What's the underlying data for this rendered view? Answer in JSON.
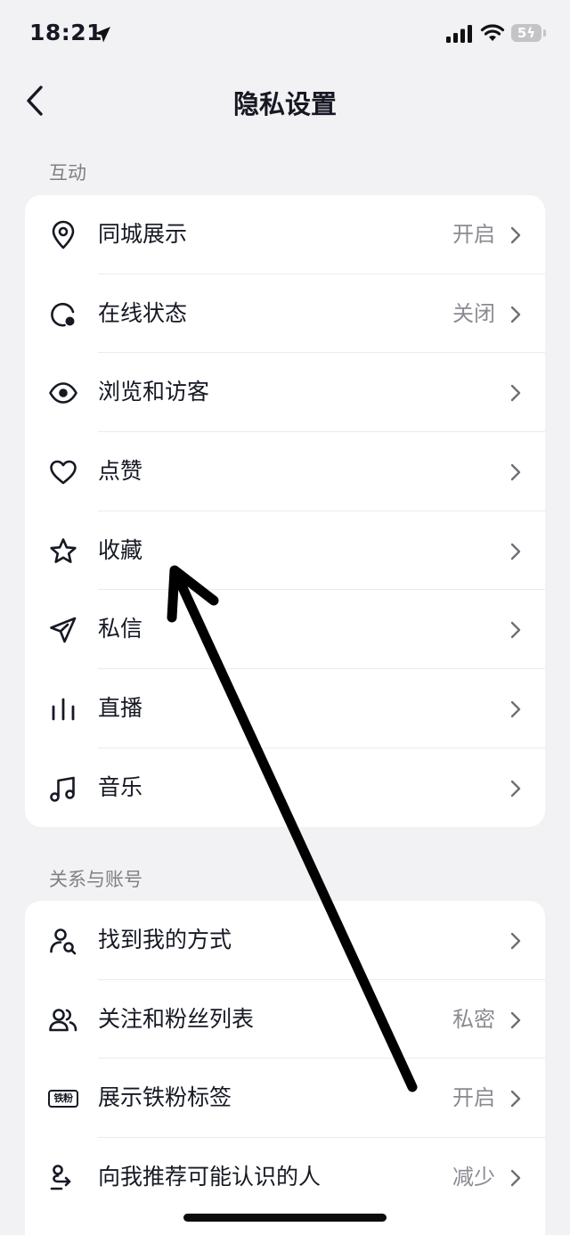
{
  "status_bar": {
    "time": "18:21",
    "battery": "5"
  },
  "header": {
    "title": "隐私设置"
  },
  "sections": [
    {
      "label": "互动",
      "items": [
        {
          "label": "同城展示",
          "value": "开启",
          "icon": "location-pin-icon"
        },
        {
          "label": "在线状态",
          "value": "关闭",
          "icon": "online-status-icon"
        },
        {
          "label": "浏览和访客",
          "value": "",
          "icon": "eye-icon"
        },
        {
          "label": "点赞",
          "value": "",
          "icon": "heart-icon"
        },
        {
          "label": "收藏",
          "value": "",
          "icon": "star-icon"
        },
        {
          "label": "私信",
          "value": "",
          "icon": "paper-plane-icon"
        },
        {
          "label": "直播",
          "value": "",
          "icon": "live-bars-icon"
        },
        {
          "label": "音乐",
          "value": "",
          "icon": "music-note-icon"
        }
      ]
    },
    {
      "label": "关系与账号",
      "items": [
        {
          "label": "找到我的方式",
          "value": "",
          "icon": "find-me-icon"
        },
        {
          "label": "关注和粉丝列表",
          "value": "私密",
          "icon": "followers-icon"
        },
        {
          "label": "展示铁粉标签",
          "value": "开启",
          "icon": "fan-tag-icon",
          "icon_text": "铁粉"
        },
        {
          "label": "向我推荐可能认识的人",
          "value": "减少",
          "icon": "recommend-people-icon"
        }
      ]
    }
  ]
}
